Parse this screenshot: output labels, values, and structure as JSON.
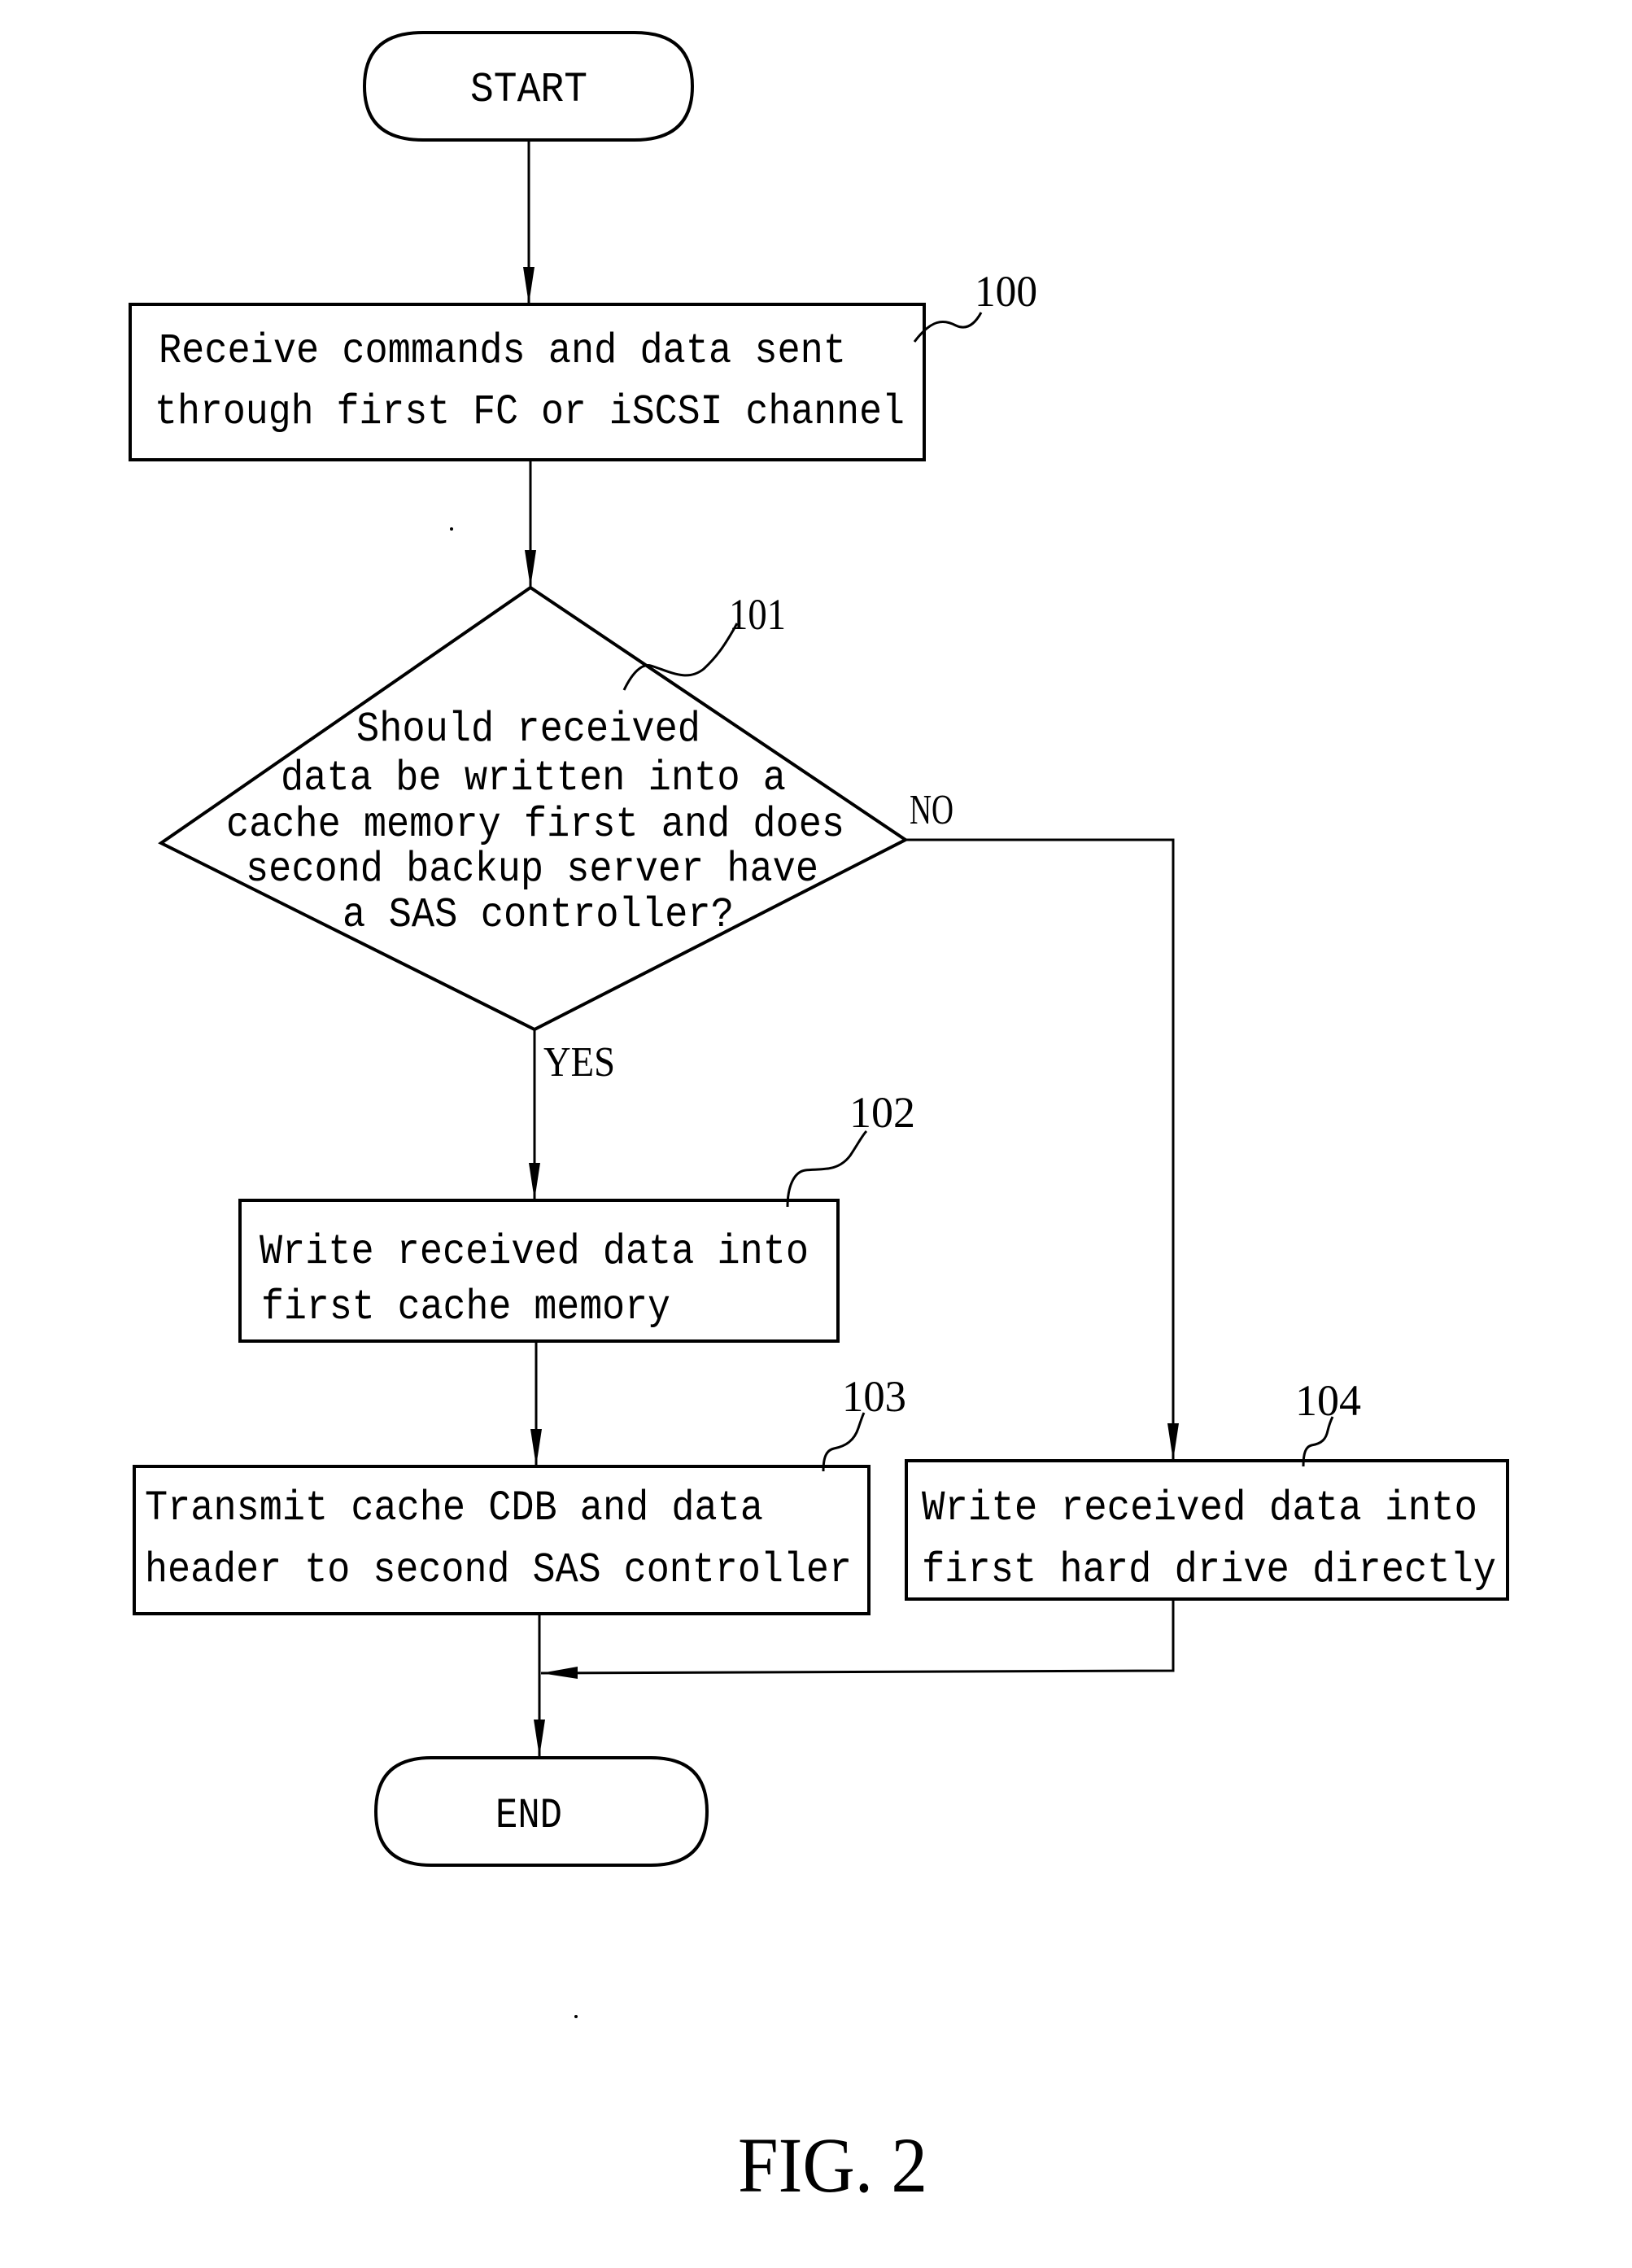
{
  "figure": {
    "caption": "FIG. 2",
    "type": "flowchart"
  },
  "nodes": {
    "start": {
      "label": "START"
    },
    "step_100": {
      "ref": "100",
      "lines": [
        "Receive commands and data sent",
        "through first FC or iSCSI channel"
      ]
    },
    "decision_101": {
      "ref": "101",
      "lines": [
        "Should received",
        "data be written into a",
        "cache memory first and does",
        "second backup server have",
        "a SAS controller?"
      ],
      "yes_label": "YES",
      "no_label": "NO"
    },
    "step_102": {
      "ref": "102",
      "lines": [
        "Write received data into",
        "first cache memory"
      ]
    },
    "step_103": {
      "ref": "103",
      "lines": [
        "Transmit cache CDB and data",
        "header to second SAS controller"
      ]
    },
    "step_104": {
      "ref": "104",
      "lines": [
        "Write received data into",
        "first hard drive directly"
      ]
    },
    "end": {
      "label": "END"
    }
  },
  "edges": [
    {
      "from": "START",
      "to": "100"
    },
    {
      "from": "100",
      "to": "101"
    },
    {
      "from": "101",
      "to": "102",
      "label": "YES"
    },
    {
      "from": "101",
      "to": "104",
      "label": "NO"
    },
    {
      "from": "102",
      "to": "103"
    },
    {
      "from": "103",
      "to": "END"
    },
    {
      "from": "104",
      "to": "END"
    }
  ]
}
